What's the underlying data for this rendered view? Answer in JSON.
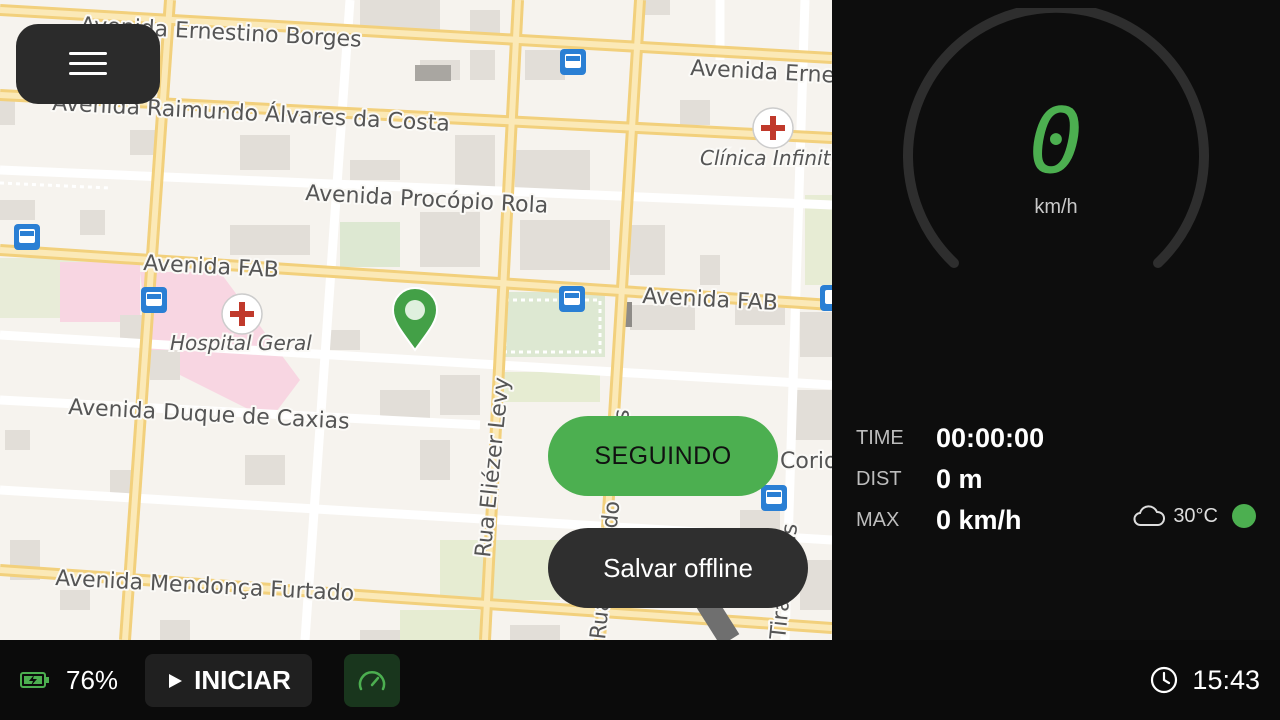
{
  "map": {
    "streets": {
      "ernestino": "Avenida Ernestino Borges",
      "ernestino_right": "Avenida Erne",
      "raimundo": "Avenida Raimundo Álvares da Costa",
      "procopio": "Avenida Procópio Rola",
      "fab_left": "Avenida FAB",
      "fab_right": "Avenida FAB",
      "duque": "Avenida Duque de Caxias",
      "mendonca": "Avenida Mendonça Furtado",
      "eliezer": "Rua Eliézer Levy",
      "corio": "Corio",
      "canera": "Rua Cândido Mendes",
      "right_vertical": "Tiradentes"
    },
    "pois": {
      "hospital": "Hospital Geral",
      "clinica": "Clínica Infinit"
    }
  },
  "menu": {
    "icon": "hamburger-icon"
  },
  "buttons": {
    "follow": "SEGUINDO",
    "save_offline": "Salvar offline"
  },
  "speedometer": {
    "value": "0",
    "unit": "km/h",
    "color": "#4caf50"
  },
  "stats": {
    "time_label": "TIME",
    "time_value": "00:00:00",
    "dist_label": "DIST",
    "dist_value": "0 m",
    "max_label": "MAX",
    "max_value": "0 km/h"
  },
  "weather": {
    "icon": "cloud-icon",
    "temp": "30°C",
    "status_color": "#4caf50"
  },
  "bottom": {
    "battery": "76%",
    "start_label": "INICIAR",
    "clock": "15:43"
  }
}
